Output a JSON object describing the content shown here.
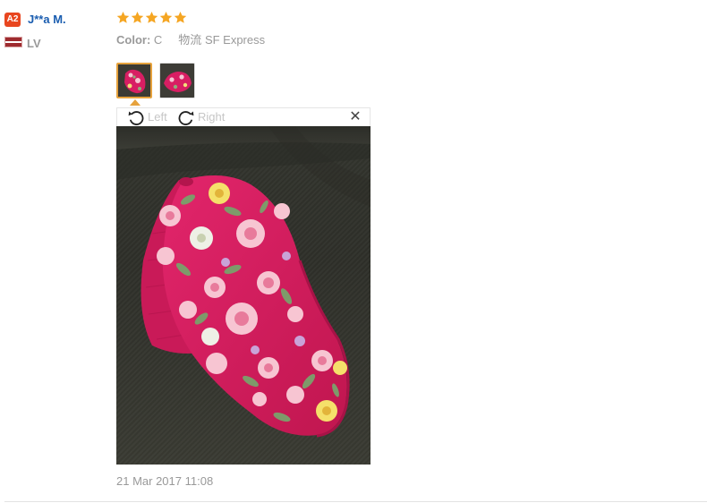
{
  "reviewer": {
    "level_badge": "A2",
    "name": "J**a M.",
    "country": "LV",
    "flag_icon": "latvia-flag-icon"
  },
  "rating": {
    "stars": 5,
    "max": 5,
    "color": "#f5a623"
  },
  "meta": {
    "color_label": "Color:",
    "color_value": "C",
    "shipping_label": "物流",
    "shipping_value": "SF Express"
  },
  "viewer": {
    "rotate_left_label": "Left",
    "rotate_right_label": "Right",
    "close_label": "✕",
    "selected_index": 0,
    "thumbnail_count": 2
  },
  "review_date": "21 Mar 2017 11:08",
  "colors": {
    "badge": "#e8461f",
    "name_link": "#1a5db0",
    "selected_border": "#e6a23c",
    "muted_text": "#999999",
    "cap_pink": "#d81e63",
    "couch": "#33352e"
  }
}
